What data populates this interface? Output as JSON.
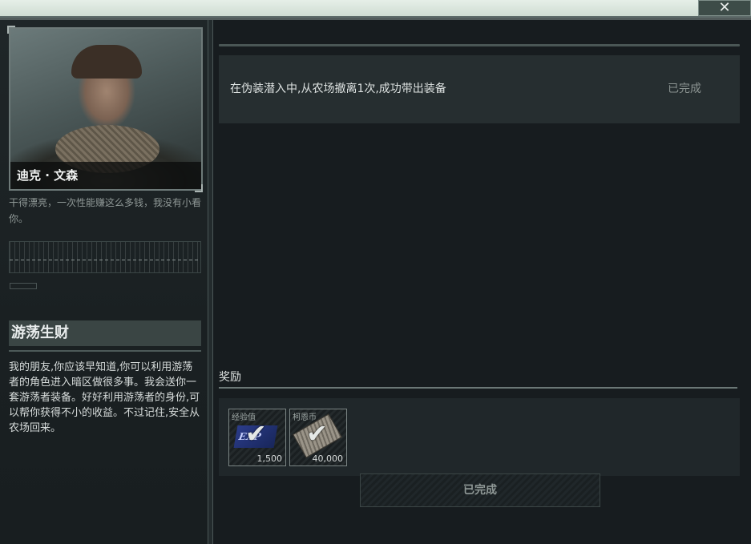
{
  "window": {
    "close_icon": "close-icon"
  },
  "trader": {
    "name": "迪克 · 文森",
    "quote": "干得漂亮，一次性能赚这么多钱，我没有小看你。"
  },
  "quest": {
    "title": "游荡生财",
    "description": "我的朋友,你应该早知道,你可以利用游荡者的角色进入暗区做很多事。我会送你一套游荡者装备。好好利用游荡者的身份,可以帮你获得不小的收益。不过记住,安全从农场回来。"
  },
  "objectives": [
    {
      "text": "在伪装潜入中,从农场撤离1次,成功带出装备",
      "status": "已完成"
    }
  ],
  "rewards": {
    "label": "奖励",
    "items": [
      {
        "name": "经验值",
        "amount": "1,500",
        "icon": "exp-icon",
        "claimed": true
      },
      {
        "name": "柯恩币",
        "amount": "40,000",
        "icon": "money-icon",
        "claimed": true
      }
    ]
  },
  "action_button": {
    "label": "已完成"
  }
}
